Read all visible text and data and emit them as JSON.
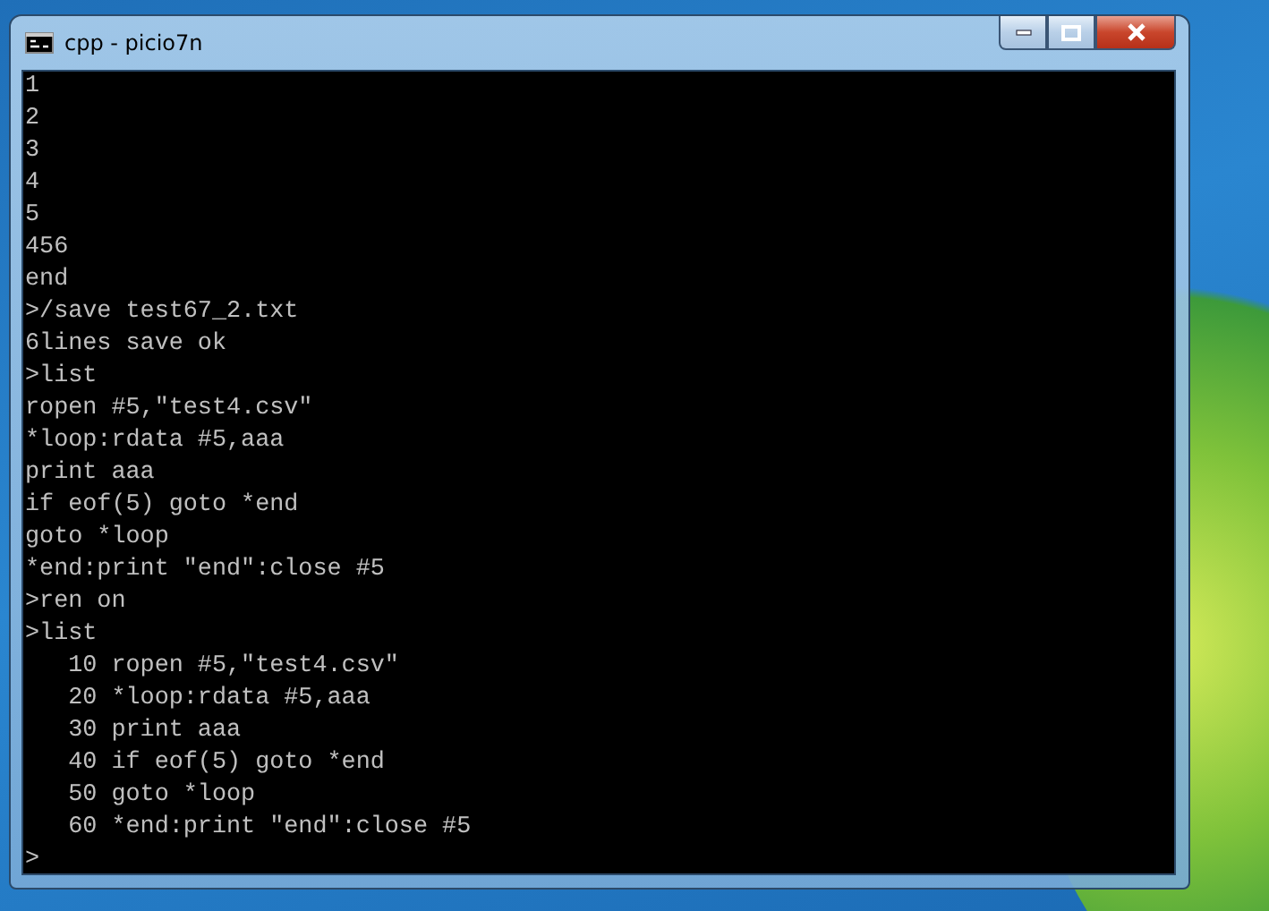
{
  "window": {
    "title": "cpp - picio7n"
  },
  "console": {
    "lines": [
      "1",
      "2",
      "3",
      "4",
      "5",
      "456",
      "end",
      ">/save test67_2.txt",
      "6lines save ok",
      ">list",
      "ropen #5,\"test4.csv\"",
      "*loop:rdata #5,aaa",
      "print aaa",
      "if eof(5) goto *end",
      "goto *loop",
      "*end:print \"end\":close #5",
      ">ren on",
      ">list",
      "   10 ropen #5,\"test4.csv\"",
      "   20 *loop:rdata #5,aaa",
      "   30 print aaa",
      "   40 if eof(5) goto *end",
      "   50 goto *loop",
      "   60 *end:print \"end\":close #5",
      ">"
    ]
  }
}
